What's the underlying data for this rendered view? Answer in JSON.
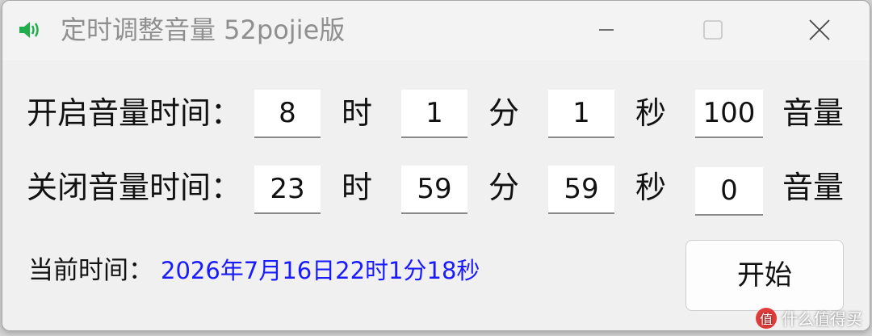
{
  "window": {
    "title": "定时调整音量 52pojie版",
    "icon": "speaker-icon"
  },
  "open_row": {
    "label": "开启音量时间：",
    "hour": "8",
    "minute": "1",
    "second": "1",
    "volume": "100"
  },
  "close_row": {
    "label": "关闭音量时间：",
    "hour": "23",
    "minute": "59",
    "second": "59",
    "volume": "0"
  },
  "units": {
    "hour": "时",
    "minute": "分",
    "second": "秒",
    "volume": "音量"
  },
  "status": {
    "label": "当前时间：",
    "value": "2026年7月16日22时1分18秒"
  },
  "start_button": {
    "label": "开始"
  },
  "watermark": {
    "text": "什么值得买"
  },
  "colors": {
    "accent_blue": "#1a1aff",
    "icon_green": "#1fae4b"
  }
}
